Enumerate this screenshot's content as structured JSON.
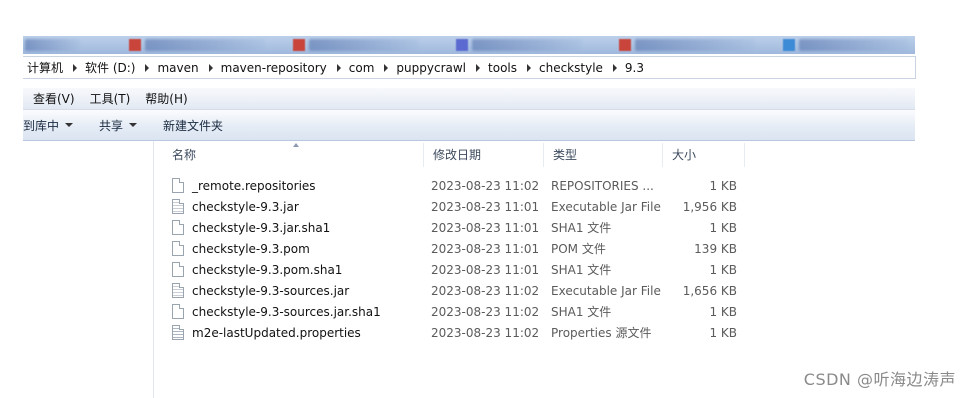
{
  "breadcrumb": [
    "计算机",
    "软件 (D:)",
    "maven",
    "maven-repository",
    "com",
    "puppycrawl",
    "tools",
    "checkstyle",
    "9.3"
  ],
  "menu": [
    "查看(V)",
    "工具(T)",
    "帮助(H)"
  ],
  "toolbar": {
    "include_library": "到库中",
    "share": "共享",
    "new_folder": "新建文件夹"
  },
  "columns": {
    "name": "名称",
    "modified": "修改日期",
    "type": "类型",
    "size": "大小"
  },
  "files": [
    {
      "name": "_remote.repositories",
      "modified": "2023-08-23 11:02",
      "type": "REPOSITORIES ...",
      "size": "1 KB",
      "icon": "blank-file-icon"
    },
    {
      "name": "checkstyle-9.3.jar",
      "modified": "2023-08-23 11:01",
      "type": "Executable Jar File",
      "size": "1,956 KB",
      "icon": "jar-file-icon"
    },
    {
      "name": "checkstyle-9.3.jar.sha1",
      "modified": "2023-08-23 11:01",
      "type": "SHA1 文件",
      "size": "1 KB",
      "icon": "blank-file-icon"
    },
    {
      "name": "checkstyle-9.3.pom",
      "modified": "2023-08-23 11:01",
      "type": "POM 文件",
      "size": "139 KB",
      "icon": "blank-file-icon"
    },
    {
      "name": "checkstyle-9.3.pom.sha1",
      "modified": "2023-08-23 11:01",
      "type": "SHA1 文件",
      "size": "1 KB",
      "icon": "blank-file-icon"
    },
    {
      "name": "checkstyle-9.3-sources.jar",
      "modified": "2023-08-23 11:02",
      "type": "Executable Jar File",
      "size": "1,656 KB",
      "icon": "jar-file-icon"
    },
    {
      "name": "checkstyle-9.3-sources.jar.sha1",
      "modified": "2023-08-23 11:02",
      "type": "SHA1 文件",
      "size": "1 KB",
      "icon": "blank-file-icon"
    },
    {
      "name": "m2e-lastUpdated.properties",
      "modified": "2023-08-23 11:02",
      "type": "Properties 源文件",
      "size": "1 KB",
      "icon": "properties-file-icon"
    }
  ],
  "watermark": "CSDN @听海边涛声",
  "colors": {
    "toolbar_bg": "#e5ecf6",
    "taskbar": "#9fb8dc",
    "header_text": "#3c4a5d"
  }
}
